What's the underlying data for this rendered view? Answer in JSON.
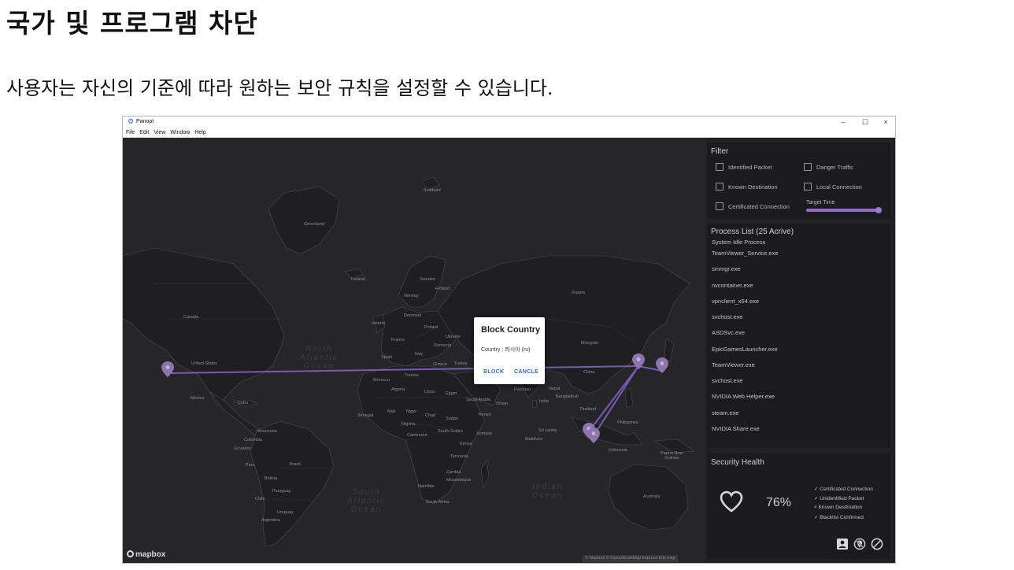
{
  "page": {
    "title": "국가 및 프로그램 차단",
    "subtitle": "사용자는 자신의 기준에 따라 원하는 보안 규칙을 설정할 수 있습니다."
  },
  "window": {
    "app_name": "Panopt",
    "menus": [
      "File",
      "Edit",
      "View",
      "Window",
      "Help"
    ],
    "controls": {
      "minimize": "–",
      "maximize": "☐",
      "close": "×"
    }
  },
  "map": {
    "ocean_labels": {
      "north_atlantic": "North\nAtlantic\nOcean",
      "south_atlantic": "South\nAtlantic\nOcean",
      "indian": "Indian\nOcean"
    },
    "labels": {
      "greenland": "Greenland",
      "svalbard": "Svalbard",
      "iceland": "Iceland",
      "sweden": "Sweden",
      "finland": "Finland",
      "norway": "Norway",
      "russia": "Russia",
      "canada": "Canada",
      "ireland": "Ireland",
      "denmark": "Denmark",
      "poland": "Poland",
      "ukraine": "Ukraine",
      "france": "France",
      "romania": "Romania",
      "spain": "Spain",
      "italy": "Italy",
      "greece": "Greece",
      "turkey": "Turkey",
      "mongolia": "Mongolia",
      "united_states": "United States",
      "china": "China",
      "morocco": "Morocco",
      "tunisia": "Tunisia",
      "algeria": "Algeria",
      "libya": "Libya",
      "egypt": "Egypt",
      "saudi_arabia": "Saudi Arabia",
      "oman": "Oman",
      "pakistan": "Pakistan",
      "nepal": "Nepal",
      "india": "India",
      "bangladesh": "Bangladesh",
      "thailand": "Thailand",
      "mexico": "Mexico",
      "cuba": "Cuba",
      "yemen": "Yemen",
      "senegal": "Senegal",
      "mali": "Mali",
      "niger": "Niger",
      "chad": "Chad",
      "sudan": "Sudan",
      "nigeria": "Nigeria",
      "cameroon": "Cameroon",
      "south_sudan": "South Sudan",
      "somalia": "Somalia",
      "kenya": "Kenya",
      "tanzania": "Tanzania",
      "zambia": "Zambia",
      "mozambique": "Mozambique",
      "namibia": "Namibia",
      "south_africa": "South Africa",
      "sri_lanka": "Sri Lanka",
      "maldives": "Maldives",
      "philippines": "Philippines",
      "indonesia": "Indonesia",
      "papua_new_guinea": "Papua New\nGuinea",
      "australia": "Australia",
      "venezuela": "Venezuela",
      "colombia": "Colombia",
      "ecuador": "Ecuador",
      "peru": "Peru",
      "brazil": "Brazil",
      "bolivia": "Bolivia",
      "paraguay": "Paraguay",
      "chile": "Chile",
      "uruguay": "Uruguay",
      "argentina": "Argentina"
    },
    "logo": "mapbox",
    "attribution": "© Mapbox © OpenStreetMap  Improve this map",
    "connection_color": "#7b59b3",
    "pin_color": "#8e74ad"
  },
  "dialog": {
    "title": "Block Country",
    "body": "Country : 러시아 (ru)",
    "block_label": "BLOCK",
    "cancel_label": "CANCLE"
  },
  "filter": {
    "title": "Filter",
    "options": [
      {
        "label": "Identified Packet",
        "checked": false
      },
      {
        "label": "Danger Traffic",
        "checked": false
      },
      {
        "label": "Known Destination",
        "checked": false
      },
      {
        "label": "Local Connection",
        "checked": false
      },
      {
        "label": "Certificated Connection",
        "checked": false
      }
    ],
    "target_time_label": "Target Time",
    "target_time_value": 1.0
  },
  "process_list": {
    "title": "Process List (25 Acrive)",
    "items": [
      "System Idle Process",
      "TeamViewer_Service.exe",
      "smmgr.exe",
      "nvcontainer.exe",
      "vpnclient_x64.exe",
      "svchost.exe",
      "ASDSvc.exe",
      "EpicGamesLauncher.exe",
      "TeamViewer.exe",
      "svchost.exe",
      "NVIDIA Web Helper.exe",
      "steam.exe",
      "NVIDIA Share.exe"
    ]
  },
  "security_health": {
    "title": "Security Health",
    "percent": "76%",
    "checks": [
      "✓ Certificated Connection",
      "✓ Unidentified Packet",
      "× Known Desitination",
      "✓ Blacklist Confirmed"
    ],
    "icons": [
      "account-box-icon",
      "blocked-location-icon",
      "block-icon"
    ]
  }
}
